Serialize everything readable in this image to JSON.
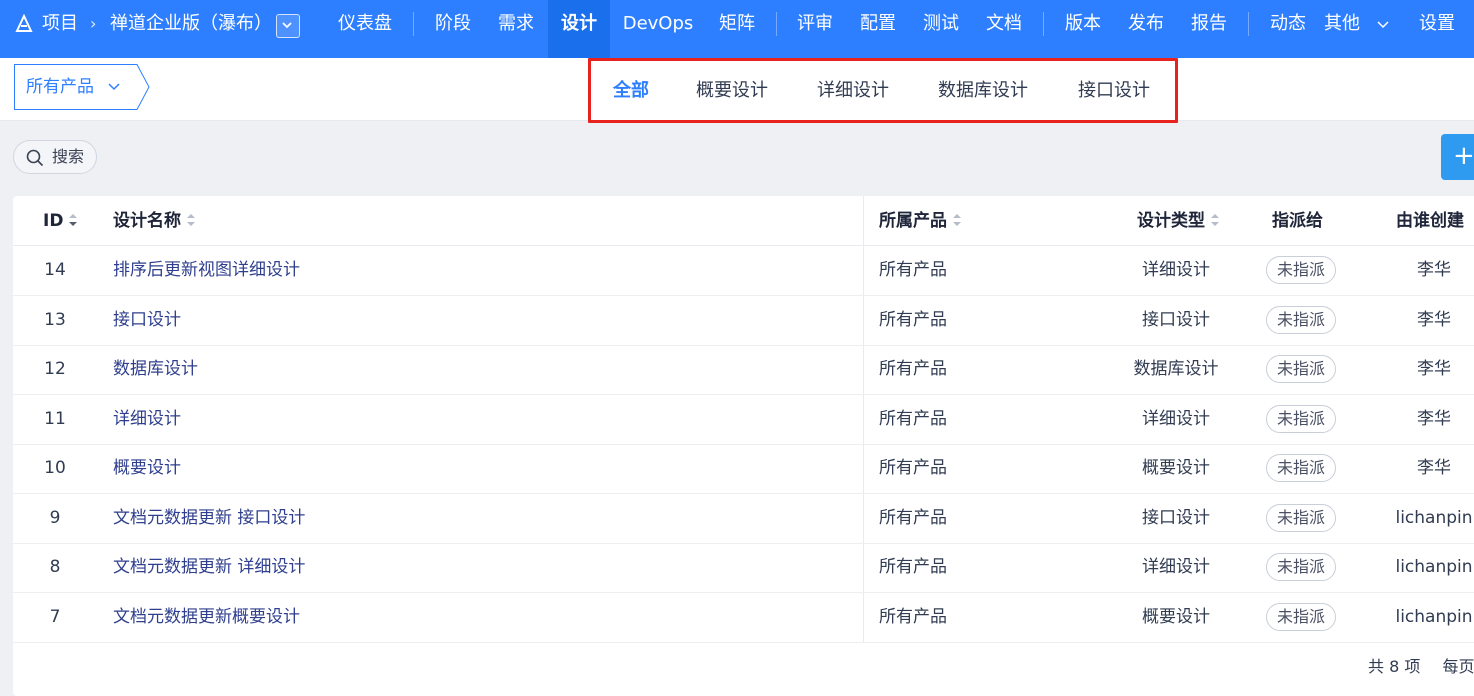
{
  "breadcrumb": {
    "icon": "project-icon",
    "project": "项目",
    "separator": "›",
    "workspace": "禅道企业版（瀑布）"
  },
  "nav": {
    "items": [
      "仪表盘",
      "阶段",
      "需求",
      "设计",
      "DevOps",
      "矩阵",
      "评审",
      "配置",
      "测试",
      "文档",
      "版本",
      "发布",
      "报告",
      "动态",
      "其他",
      "设置"
    ],
    "active": "设计"
  },
  "product_select": {
    "label": "所有产品"
  },
  "design_type_tabs": {
    "items": [
      "全部",
      "概要设计",
      "详细设计",
      "数据库设计",
      "接口设计"
    ],
    "active": "全部"
  },
  "toolbar": {
    "search_label": "搜索",
    "create_label": "+"
  },
  "table": {
    "columns": [
      "ID",
      "设计名称",
      "所属产品",
      "设计类型",
      "指派给",
      "由谁创建"
    ],
    "rows": [
      {
        "id": "14",
        "name": "排序后更新视图详细设计",
        "product": "所有产品",
        "type": "详细设计",
        "assignee": "未指派",
        "creator": "李华"
      },
      {
        "id": "13",
        "name": "接口设计",
        "product": "所有产品",
        "type": "接口设计",
        "assignee": "未指派",
        "creator": "李华"
      },
      {
        "id": "12",
        "name": "数据库设计",
        "product": "所有产品",
        "type": "数据库设计",
        "assignee": "未指派",
        "creator": "李华"
      },
      {
        "id": "11",
        "name": "详细设计",
        "product": "所有产品",
        "type": "详细设计",
        "assignee": "未指派",
        "creator": "李华"
      },
      {
        "id": "10",
        "name": "概要设计",
        "product": "所有产品",
        "type": "概要设计",
        "assignee": "未指派",
        "creator": "李华"
      },
      {
        "id": "9",
        "name": "文档元数据更新 接口设计",
        "product": "所有产品",
        "type": "接口设计",
        "assignee": "未指派",
        "creator": "lichanpin"
      },
      {
        "id": "8",
        "name": "文档元数据更新 详细设计",
        "product": "所有产品",
        "type": "详细设计",
        "assignee": "未指派",
        "creator": "lichanpin"
      },
      {
        "id": "7",
        "name": "文档元数据更新概要设计",
        "product": "所有产品",
        "type": "概要设计",
        "assignee": "未指派",
        "creator": "lichanpin"
      }
    ]
  },
  "pagination": {
    "total_text": "共 8 项",
    "per_page_text": "每页"
  },
  "colors": {
    "primary": "#2e7fff",
    "highlight_border": "#e8231d",
    "link": "#2f3f8e"
  }
}
